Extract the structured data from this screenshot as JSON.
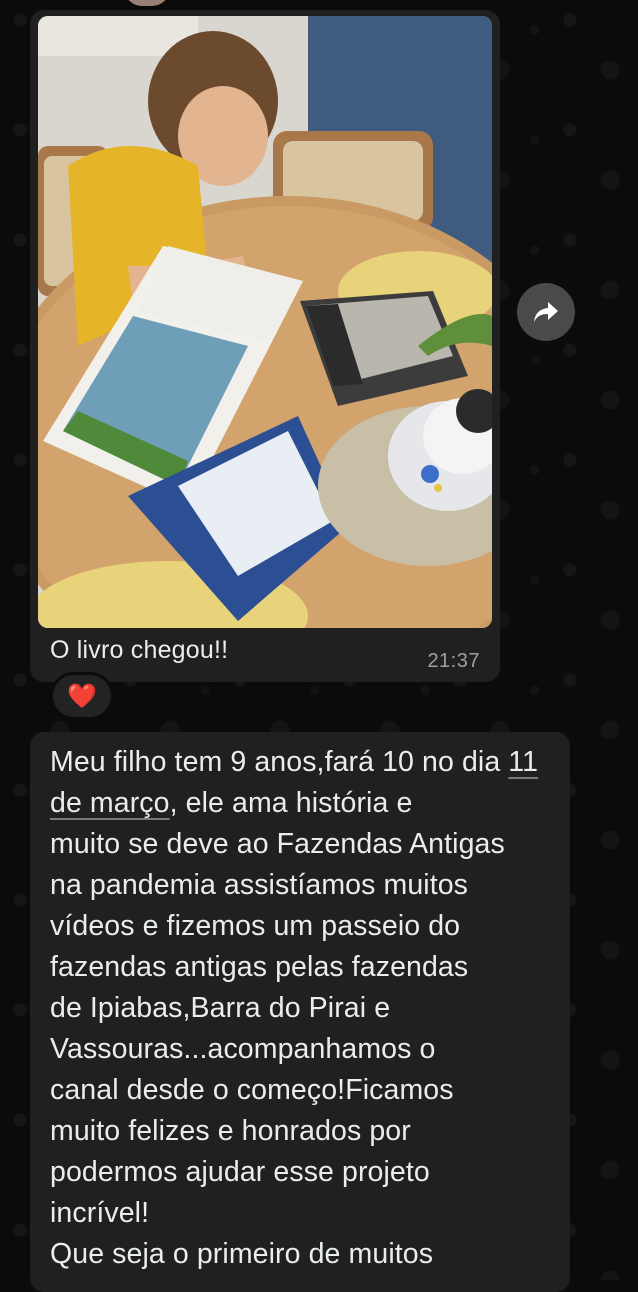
{
  "chat": {
    "photo_message": {
      "caption": "O livro chegou!!",
      "time": "21:37",
      "reaction": "❤️",
      "image_alt": "Menino lendo livro Fazendas Antigas"
    },
    "text_message": {
      "before_link": "Meu filho tem 9 anos,fará 10 no dia ",
      "link": "11 de março",
      "after_link": ", ele ama história e\nmuito se deve ao Fazendas Antigas\nna pandemia assistíamos muitos\nvídeos e fizemos um passeio do\nfazendas antigas pelas fazendas\nde Ipiabas,Barra do Pirai e\nVassouras...acompanhamos o\ncanal desde o começo!Ficamos\nmuito felizes e honrados por\npodermos ajudar esse projeto\nincrível!\nQue seja o primeiro de muitos"
    },
    "icons": {
      "forward": "forward-arrow-icon",
      "reaction": "heart-icon"
    }
  }
}
